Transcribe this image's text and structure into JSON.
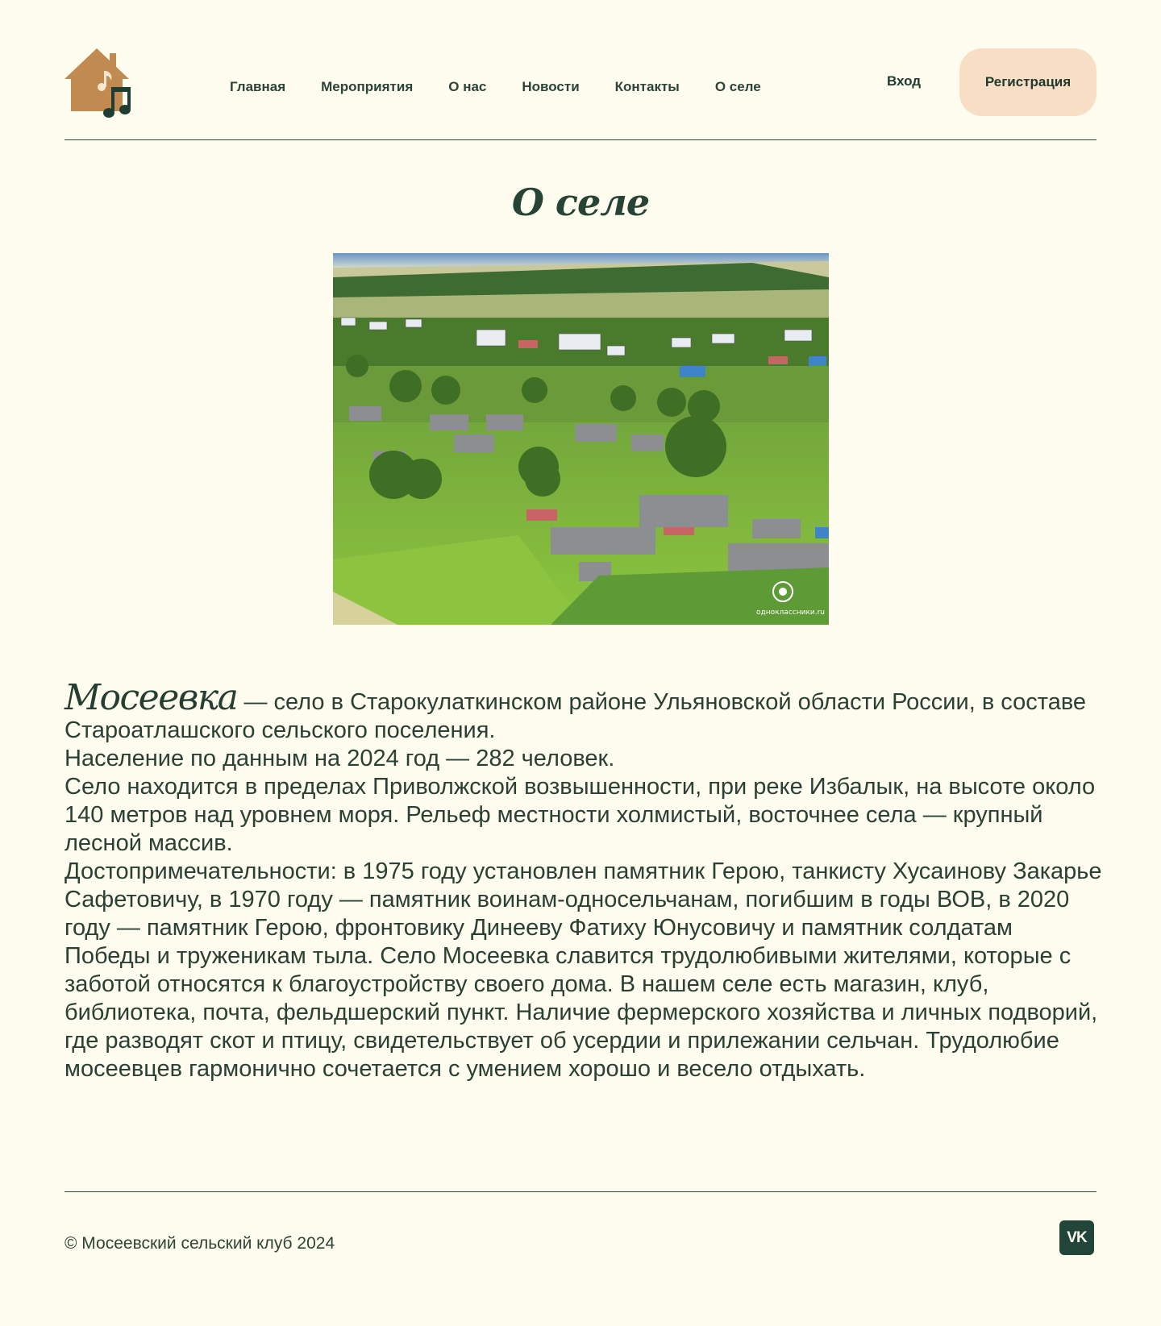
{
  "nav": {
    "items": [
      "Главная",
      "Мероприятия",
      "О нас",
      "Новости",
      "Контакты",
      "О селе"
    ],
    "login": "Вход",
    "register": "Регистрация"
  },
  "page": {
    "title": "О селе",
    "photo_watermark": "одноклассники.ru",
    "intro_name": "Мосеевка",
    "intro_rest": " — село в Старокулаткинском районе Ульяновской области России, в составе Староатлашского сельского поселения.",
    "population": "Население по данным на 2024 год — 282 человек.",
    "geography": "Село находится в пределах Приволжской возвышенности, при реке Избалык, на высоте около 140 метров над уровнем моря. Рельеф местности холмистый, восточнее села — крупный лесной массив.",
    "landmarks": "Достопримечательности: в 1975 году установлен памятник Герою, танкисту Хусаинову Закарье Сафетовичу, в 1970 году — памятник воинам-односельчанам, погибшим в годы ВОВ, в 2020 году — памятник Герою, фронтовику Динееву Фатиху Юнусовичу и памятник солдатам Победы и труженикам тыла. Село Мосеевка славится трудолюбивыми жителями, которые с заботой относятся к благоустройству своего дома. В нашем селе есть магазин, клуб, библиотека, почта, фельдшерский пункт. Наличие фермерского хозяйства и личных подворий, где разводят скот и птицу, свидетельствует об усердии и прилежании сельчан. Трудолюбие мосеевцев гармонично сочетается с умением хорошо и весело отдыхать."
  },
  "footer": {
    "copyright": "© Мосеевский сельский клуб 2024",
    "vk_label": "VK"
  },
  "colors": {
    "background": "#fdfcee",
    "text": "#264235",
    "register_bg": "#f8dec4",
    "logo_house": "#c08a50",
    "vk_bg": "#22453a"
  },
  "icons": [
    "house-music-logo-icon",
    "vk-icon"
  ]
}
